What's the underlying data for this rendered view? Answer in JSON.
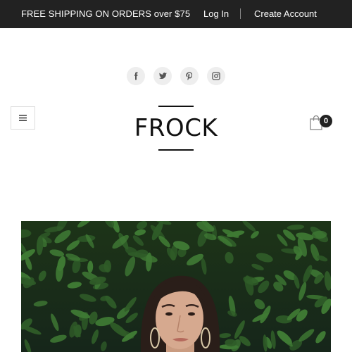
{
  "topbar": {
    "promo": "FREE SHIPPING ON ORDERS over $75",
    "login": "Log In",
    "create_account": "Create Account"
  },
  "social": [
    {
      "icon": "facebook-icon"
    },
    {
      "icon": "twitter-icon"
    },
    {
      "icon": "pinterest-icon"
    },
    {
      "icon": "instagram-icon"
    }
  ],
  "header": {
    "logo": "FROCK",
    "menu_icon": "hamburger-icon",
    "cart_icon": "shopping-bag-icon",
    "cart_count": "0"
  },
  "hero": {
    "image": "woman-portrait-in-front-of-green-leaves"
  },
  "colors": {
    "topbar_bg": "#222222",
    "topbar_text": "#ffffff",
    "social_bg": "#eeeeee",
    "social_icon": "#555555",
    "leaf_dark": "#1e3318",
    "leaf_light": "#3f7a34"
  }
}
